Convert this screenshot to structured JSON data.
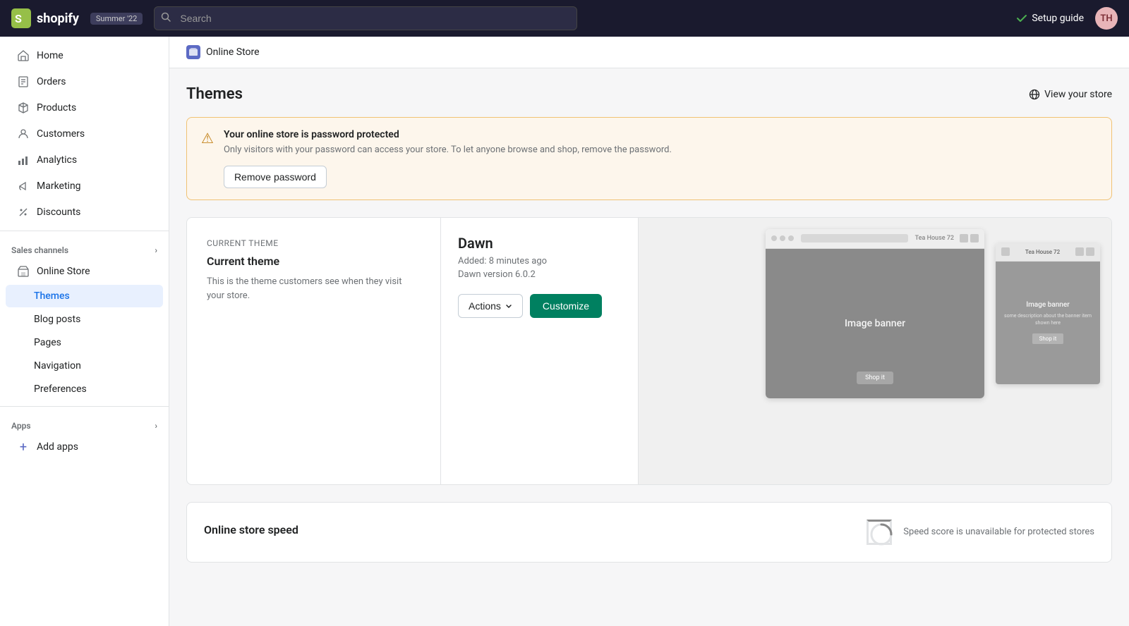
{
  "topbar": {
    "logo_text": "shopify",
    "badge_text": "Summer '22",
    "search_placeholder": "Search",
    "setup_guide_label": "Setup guide",
    "avatar_initials": "TH",
    "avatar_bg": "#e8b4b8",
    "avatar_color": "#7b2d35"
  },
  "sidebar": {
    "nav_items": [
      {
        "id": "home",
        "label": "Home",
        "icon": "home"
      },
      {
        "id": "orders",
        "label": "Orders",
        "icon": "orders"
      },
      {
        "id": "products",
        "label": "Products",
        "icon": "products"
      },
      {
        "id": "customers",
        "label": "Customers",
        "icon": "customers"
      },
      {
        "id": "analytics",
        "label": "Analytics",
        "icon": "analytics"
      },
      {
        "id": "marketing",
        "label": "Marketing",
        "icon": "marketing"
      },
      {
        "id": "discounts",
        "label": "Discounts",
        "icon": "discounts"
      }
    ],
    "sales_channels_label": "Sales channels",
    "sales_channels_items": [
      {
        "id": "online-store",
        "label": "Online Store",
        "icon": "store",
        "active": false
      }
    ],
    "online_store_sub": [
      {
        "id": "themes",
        "label": "Themes",
        "active": true
      },
      {
        "id": "blog-posts",
        "label": "Blog posts",
        "active": false
      },
      {
        "id": "pages",
        "label": "Pages",
        "active": false
      },
      {
        "id": "navigation",
        "label": "Navigation",
        "active": false
      },
      {
        "id": "preferences",
        "label": "Preferences",
        "active": false
      }
    ],
    "apps_label": "Apps",
    "add_apps_label": "Add apps"
  },
  "breadcrumb": {
    "icon_label": "OS",
    "text": "Online Store"
  },
  "page": {
    "title": "Themes",
    "view_store_label": "View your store"
  },
  "alert": {
    "icon": "⚠",
    "title": "Your online store is password protected",
    "description": "Only visitors with your password can access your store. To let anyone browse and shop, remove the password.",
    "button_label": "Remove password"
  },
  "current_theme": {
    "section_heading": "Current theme",
    "description": "This is the theme customers see when they visit your store.",
    "theme_name": "Dawn",
    "added_text": "Added: 8 minutes ago",
    "version_text": "Dawn version 6.0.2",
    "actions_label": "Actions",
    "customize_label": "Customize",
    "image_banner_main": "Image banner",
    "image_banner_secondary": "Image banner"
  },
  "speed_section": {
    "title": "Online store speed",
    "description": "Speed score is unavailable for protected stores"
  }
}
